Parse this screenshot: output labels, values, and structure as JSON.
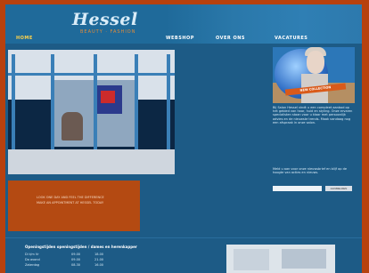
{
  "brand": {
    "name": "Hessel",
    "sub": "BEAUTY · FASHION"
  },
  "nav": [
    {
      "label": "HOME",
      "active": true
    },
    {
      "label": "WEBSHOP",
      "active": false
    },
    {
      "label": "OVER ONS",
      "active": false
    },
    {
      "label": "VACATURES",
      "active": false
    }
  ],
  "promo": {
    "banner": "NEW COLLECTION"
  },
  "content": {
    "orange_box_line1": "LOOK ONE DAY AND FEEL THE DIFFERENCE",
    "orange_box_line2": "MAKE AN APPOINTMENT AT HESSEL TODAY",
    "sidebar_text": "Bij Salon Hessel vindt u een compleet aanbod op het gebied van haar, huid en styling. Onze ervaren specialisten staan voor u klaar met persoonlijk advies en de nieuwste trends. Maak vandaag nog een afspraak in onze salon.",
    "sidebar_text2": "Meld u aan voor onze nieuwsbrief en blijf op de hoogte van acties en nieuws.",
    "newsletter_button": "AANMELDEN"
  },
  "hours": {
    "title": "Openingstijden openingstijden / dames en herenkapper",
    "rows": [
      {
        "day": "Di t/m Vr",
        "from": "09.00",
        "to": "18.00"
      },
      {
        "day": "Do avond",
        "from": "09.00",
        "to": "21.00"
      },
      {
        "day": "Zaterdag",
        "from": "08.30",
        "to": "16.00"
      }
    ]
  },
  "colors": {
    "frame": "#b7410e",
    "page": "#1d5b86",
    "nav_active": "#ffd24a",
    "accent": "#b44a12"
  }
}
